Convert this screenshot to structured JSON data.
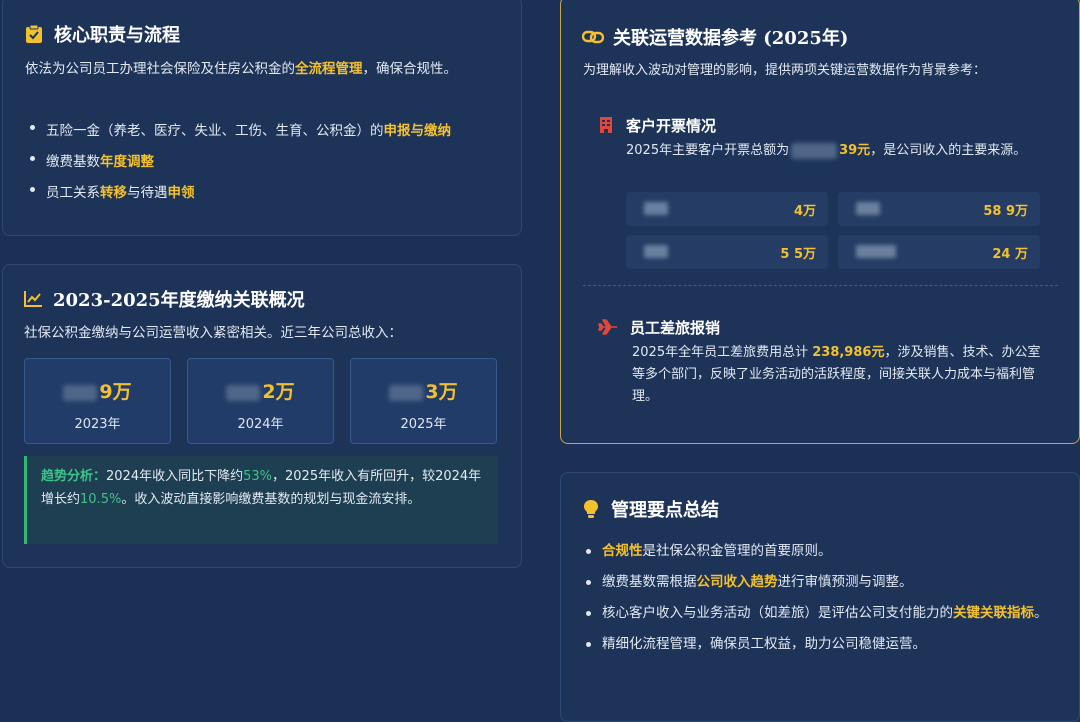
{
  "duties": {
    "title": "核心职责与流程",
    "intro_pre": "依法为公司员工办理社会保险及住房公积金的",
    "intro_hl": "全流程管理",
    "intro_post": "，确保合规性。",
    "bullets": [
      {
        "pre": "五险一金（养老、医疗、失业、工伤、生育、公积金）的",
        "hl": "申报与缴纳",
        "post": ""
      },
      {
        "pre": "缴费基数",
        "hl": "年度调整",
        "post": ""
      },
      {
        "pre": "员工关系",
        "hl": "转移",
        "mid": "与待遇",
        "hl2": "申领"
      }
    ]
  },
  "overview": {
    "title": "2023-2025年度缴纳关联概况",
    "intro": "社保公积金缴纳与公司运营收入紧密相关。近三年公司总收入：",
    "stats": [
      {
        "value": "9万",
        "year": "2023年"
      },
      {
        "value": "2万",
        "year": "2024年"
      },
      {
        "value": "3万",
        "year": "2025年"
      }
    ],
    "trend": {
      "label": "趋势分析：",
      "t1": "2024年收入同比下降约",
      "v1": "53%",
      "t2": "，2025年收入有所回升，较2024年增长约",
      "v2": "10.5%",
      "t3": "。收入波动直接影响缴费基数的规划与现金流安排。"
    }
  },
  "reference": {
    "title": "关联运营数据参考 (2025年)",
    "intro": "为理解收入波动对管理的影响，提供两项关键运营数据作为背景参考：",
    "invoice": {
      "title": "客户开票情况",
      "text_pre": "2025年主要客户开票总额为",
      "amount": "39元",
      "text_post": "，是公司收入的主要来源。",
      "tiles": [
        {
          "amount": "4万"
        },
        {
          "amount": "58 9万"
        },
        {
          "amount": "5 5万"
        },
        {
          "amount": "24 万"
        }
      ]
    },
    "travel": {
      "title": "员工差旅报销",
      "text_pre": "2025年全年员工差旅费用总计",
      "amount": "238,986元",
      "text_post": "，涉及销售、技术、办公室等多个部门，反映了业务活动的活跃程度，间接关联人力成本与福利管理。"
    }
  },
  "summary": {
    "title": "管理要点总结",
    "bullets": [
      {
        "hl": "合规性",
        "post": "是社保公积金管理的首要原则。"
      },
      {
        "pre": "缴费基数需根据",
        "hl": "公司收入趋势",
        "post": "进行审慎预测与调整。"
      },
      {
        "pre": "核心客户收入与业务活动（如差旅）是评估公司支付能力的",
        "hl": "关键关联指标",
        "post": "。"
      },
      {
        "pre": "精细化流程管理，确保员工权益，助力公司稳健运营。"
      }
    ]
  },
  "colors": {
    "accent": "#f3c12e",
    "positive": "#3fc28a",
    "background": "#1b3054",
    "card": "#1d3358",
    "alert": "#e0483c"
  },
  "icons": {
    "duties": "clipboard-check-icon",
    "overview": "line-chart-icon",
    "reference": "link-icon",
    "invoice": "building-icon",
    "travel": "plane-icon",
    "summary": "lightbulb-icon"
  }
}
